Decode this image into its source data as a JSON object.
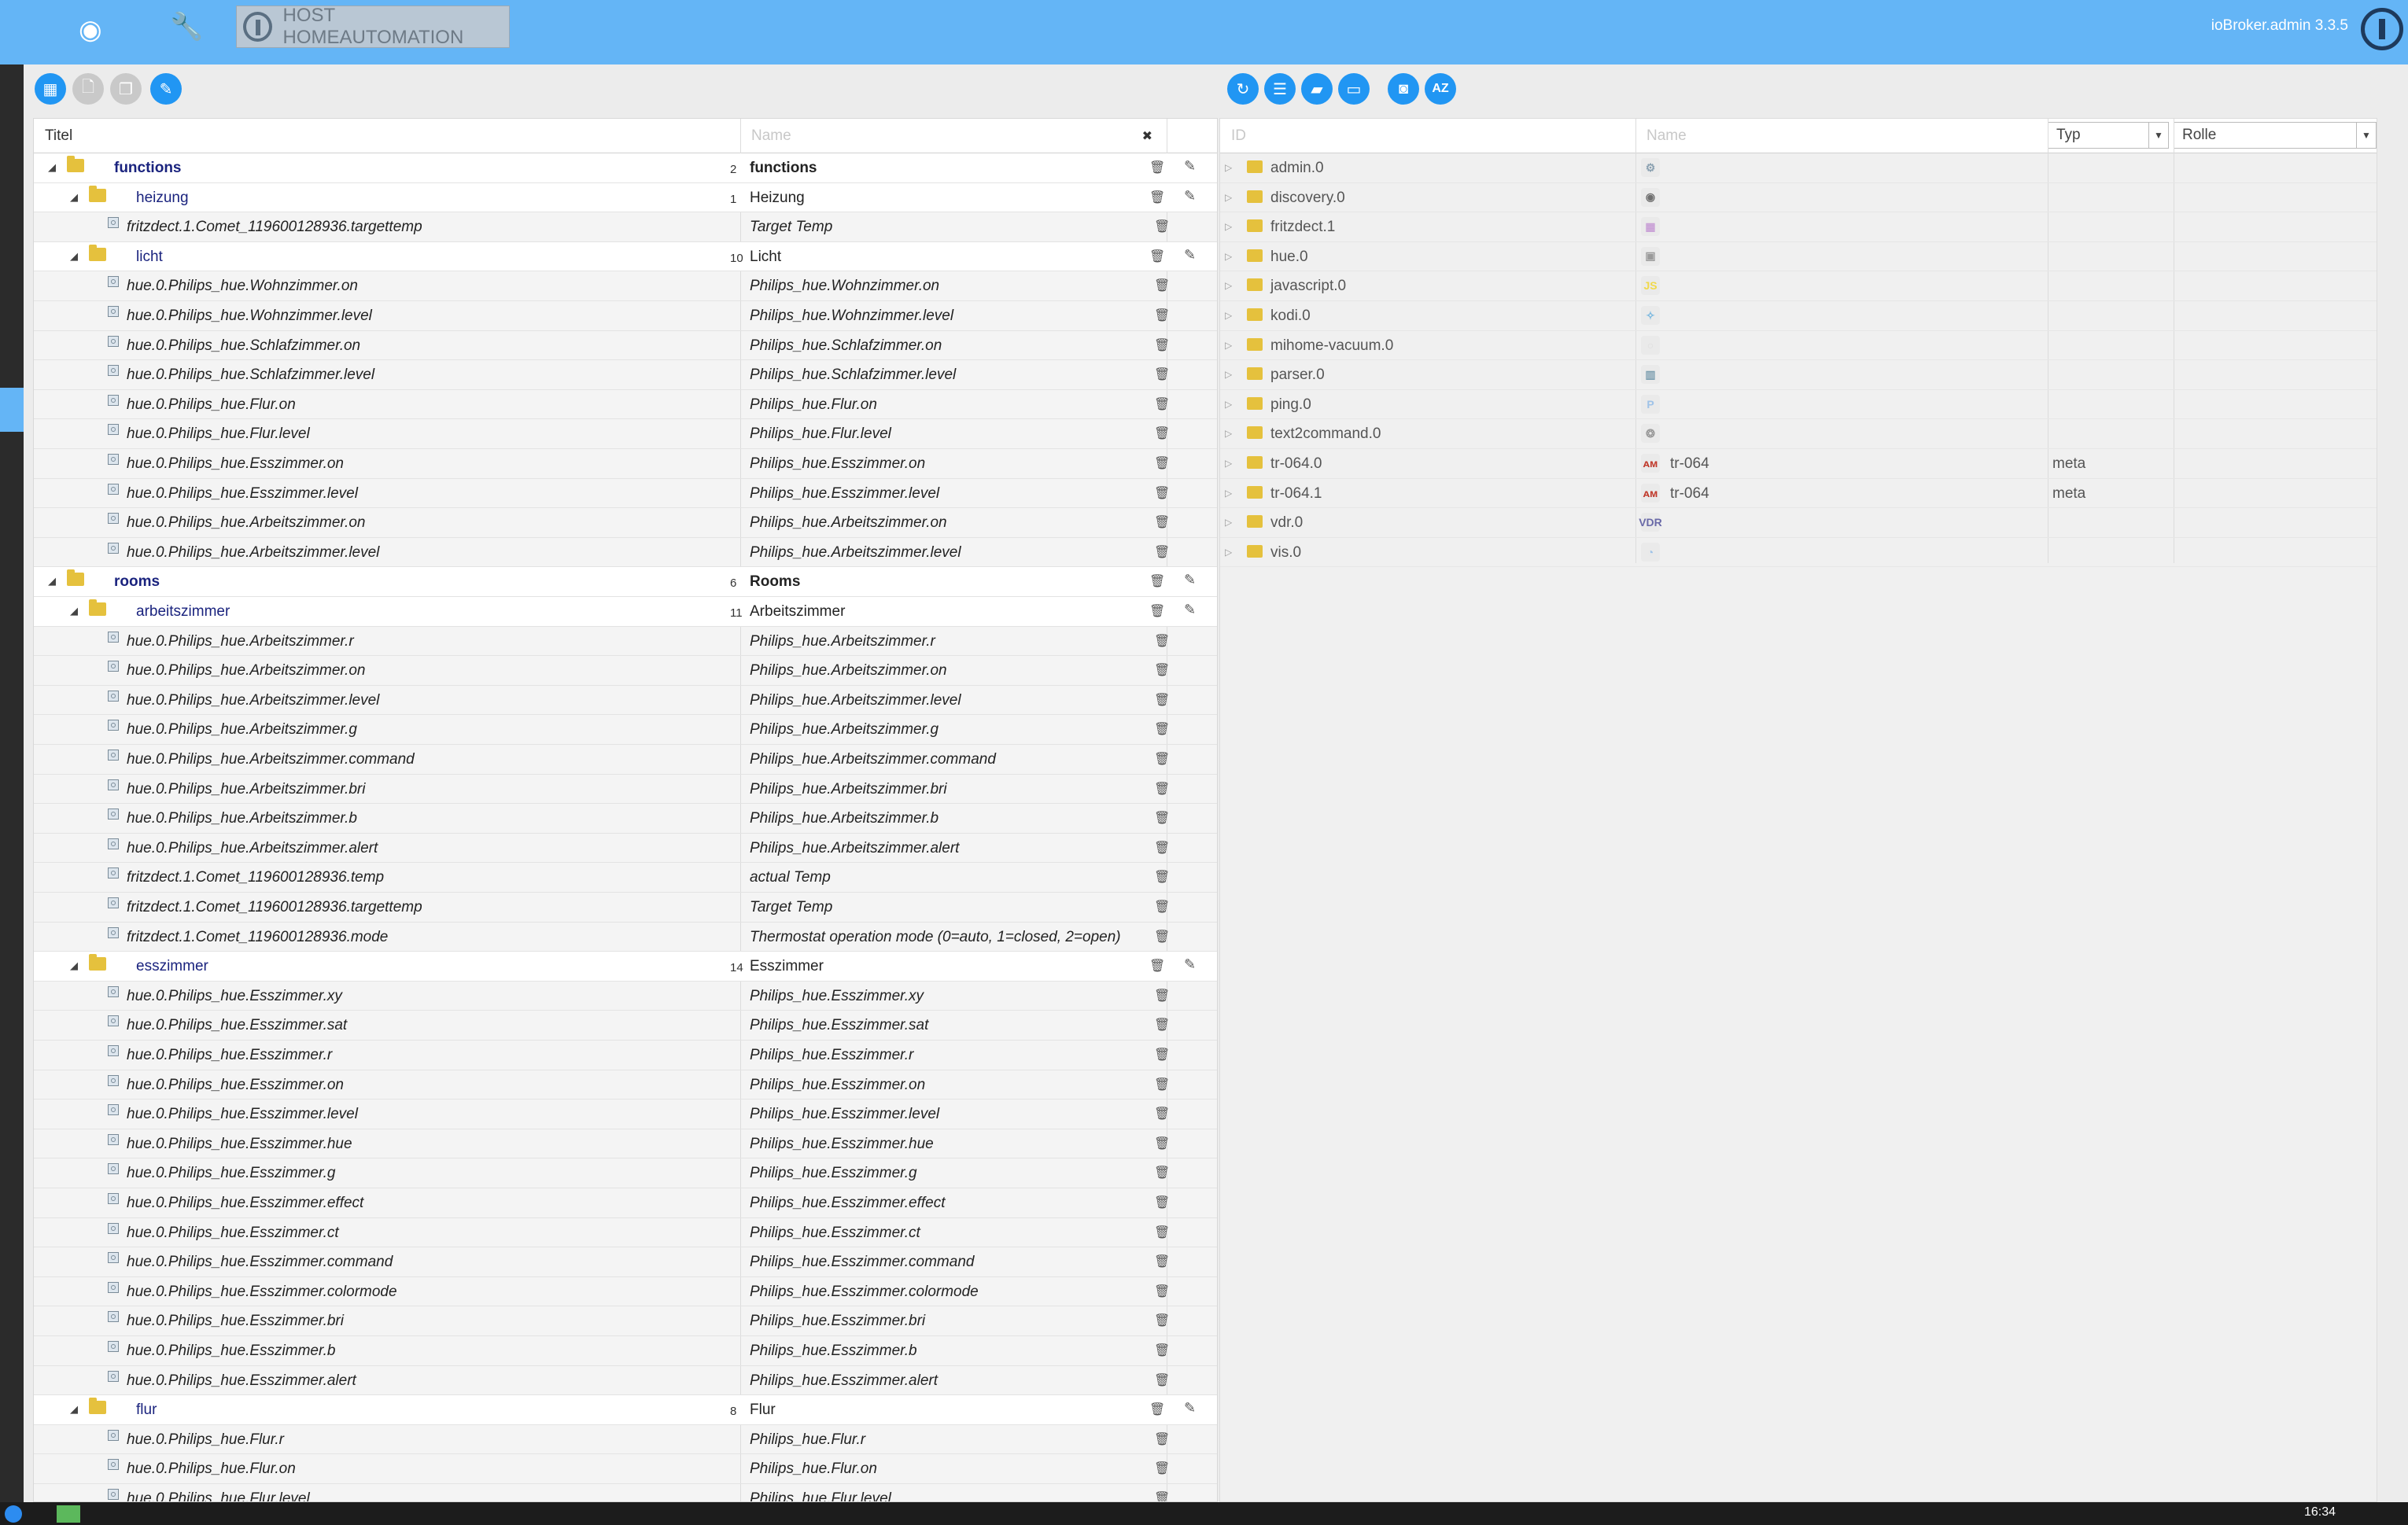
{
  "header": {
    "host_label": "HOST HOMEAUTOMATION",
    "version": "ioBroker.admin 3.3.5",
    "icons": [
      "eye-icon",
      "wrench-icon"
    ]
  },
  "left_table": {
    "columns": {
      "title": "Titel",
      "name_placeholder": "Name"
    },
    "rows": [
      {
        "type": "group",
        "level": 0,
        "title": "functions",
        "count": "2",
        "name": "functions",
        "bold": true
      },
      {
        "type": "group",
        "level": 1,
        "title": "heizung",
        "count": "1",
        "name": "Heizung"
      },
      {
        "type": "state",
        "title": "fritzdect.1.Comet_119600128936.targettemp",
        "name": "Target Temp"
      },
      {
        "type": "group",
        "level": 1,
        "title": "licht",
        "count": "10",
        "name": "Licht"
      },
      {
        "type": "state",
        "title": "hue.0.Philips_hue.Wohnzimmer.on",
        "name": "Philips_hue.Wohnzimmer.on"
      },
      {
        "type": "state",
        "title": "hue.0.Philips_hue.Wohnzimmer.level",
        "name": "Philips_hue.Wohnzimmer.level"
      },
      {
        "type": "state",
        "title": "hue.0.Philips_hue.Schlafzimmer.on",
        "name": "Philips_hue.Schlafzimmer.on"
      },
      {
        "type": "state",
        "title": "hue.0.Philips_hue.Schlafzimmer.level",
        "name": "Philips_hue.Schlafzimmer.level"
      },
      {
        "type": "state",
        "title": "hue.0.Philips_hue.Flur.on",
        "name": "Philips_hue.Flur.on"
      },
      {
        "type": "state",
        "title": "hue.0.Philips_hue.Flur.level",
        "name": "Philips_hue.Flur.level"
      },
      {
        "type": "state",
        "title": "hue.0.Philips_hue.Esszimmer.on",
        "name": "Philips_hue.Esszimmer.on"
      },
      {
        "type": "state",
        "title": "hue.0.Philips_hue.Esszimmer.level",
        "name": "Philips_hue.Esszimmer.level"
      },
      {
        "type": "state",
        "title": "hue.0.Philips_hue.Arbeitszimmer.on",
        "name": "Philips_hue.Arbeitszimmer.on"
      },
      {
        "type": "state",
        "title": "hue.0.Philips_hue.Arbeitszimmer.level",
        "name": "Philips_hue.Arbeitszimmer.level"
      },
      {
        "type": "group",
        "level": 0,
        "title": "rooms",
        "count": "6",
        "name": "Rooms",
        "bold": true
      },
      {
        "type": "group",
        "level": 1,
        "title": "arbeitszimmer",
        "count": "11",
        "name": "Arbeitszimmer"
      },
      {
        "type": "state",
        "title": "hue.0.Philips_hue.Arbeitszimmer.r",
        "name": "Philips_hue.Arbeitszimmer.r"
      },
      {
        "type": "state",
        "title": "hue.0.Philips_hue.Arbeitszimmer.on",
        "name": "Philips_hue.Arbeitszimmer.on"
      },
      {
        "type": "state",
        "title": "hue.0.Philips_hue.Arbeitszimmer.level",
        "name": "Philips_hue.Arbeitszimmer.level"
      },
      {
        "type": "state",
        "title": "hue.0.Philips_hue.Arbeitszimmer.g",
        "name": "Philips_hue.Arbeitszimmer.g"
      },
      {
        "type": "state",
        "title": "hue.0.Philips_hue.Arbeitszimmer.command",
        "name": "Philips_hue.Arbeitszimmer.command"
      },
      {
        "type": "state",
        "title": "hue.0.Philips_hue.Arbeitszimmer.bri",
        "name": "Philips_hue.Arbeitszimmer.bri"
      },
      {
        "type": "state",
        "title": "hue.0.Philips_hue.Arbeitszimmer.b",
        "name": "Philips_hue.Arbeitszimmer.b"
      },
      {
        "type": "state",
        "title": "hue.0.Philips_hue.Arbeitszimmer.alert",
        "name": "Philips_hue.Arbeitszimmer.alert"
      },
      {
        "type": "state",
        "title": "fritzdect.1.Comet_119600128936.temp",
        "name": "actual Temp"
      },
      {
        "type": "state",
        "title": "fritzdect.1.Comet_119600128936.targettemp",
        "name": "Target Temp"
      },
      {
        "type": "state",
        "title": "fritzdect.1.Comet_119600128936.mode",
        "name": "Thermostat operation mode (0=auto, 1=closed, 2=open)"
      },
      {
        "type": "group",
        "level": 1,
        "title": "esszimmer",
        "count": "14",
        "name": "Esszimmer"
      },
      {
        "type": "state",
        "title": "hue.0.Philips_hue.Esszimmer.xy",
        "name": "Philips_hue.Esszimmer.xy"
      },
      {
        "type": "state",
        "title": "hue.0.Philips_hue.Esszimmer.sat",
        "name": "Philips_hue.Esszimmer.sat"
      },
      {
        "type": "state",
        "title": "hue.0.Philips_hue.Esszimmer.r",
        "name": "Philips_hue.Esszimmer.r"
      },
      {
        "type": "state",
        "title": "hue.0.Philips_hue.Esszimmer.on",
        "name": "Philips_hue.Esszimmer.on"
      },
      {
        "type": "state",
        "title": "hue.0.Philips_hue.Esszimmer.level",
        "name": "Philips_hue.Esszimmer.level"
      },
      {
        "type": "state",
        "title": "hue.0.Philips_hue.Esszimmer.hue",
        "name": "Philips_hue.Esszimmer.hue"
      },
      {
        "type": "state",
        "title": "hue.0.Philips_hue.Esszimmer.g",
        "name": "Philips_hue.Esszimmer.g"
      },
      {
        "type": "state",
        "title": "hue.0.Philips_hue.Esszimmer.effect",
        "name": "Philips_hue.Esszimmer.effect"
      },
      {
        "type": "state",
        "title": "hue.0.Philips_hue.Esszimmer.ct",
        "name": "Philips_hue.Esszimmer.ct"
      },
      {
        "type": "state",
        "title": "hue.0.Philips_hue.Esszimmer.command",
        "name": "Philips_hue.Esszimmer.command"
      },
      {
        "type": "state",
        "title": "hue.0.Philips_hue.Esszimmer.colormode",
        "name": "Philips_hue.Esszimmer.colormode"
      },
      {
        "type": "state",
        "title": "hue.0.Philips_hue.Esszimmer.bri",
        "name": "Philips_hue.Esszimmer.bri"
      },
      {
        "type": "state",
        "title": "hue.0.Philips_hue.Esszimmer.b",
        "name": "Philips_hue.Esszimmer.b"
      },
      {
        "type": "state",
        "title": "hue.0.Philips_hue.Esszimmer.alert",
        "name": "Philips_hue.Esszimmer.alert"
      },
      {
        "type": "group",
        "level": 1,
        "title": "flur",
        "count": "8",
        "name": "Flur"
      },
      {
        "type": "state",
        "title": "hue.0.Philips_hue.Flur.r",
        "name": "Philips_hue.Flur.r"
      },
      {
        "type": "state",
        "title": "hue.0.Philips_hue.Flur.on",
        "name": "Philips_hue.Flur.on"
      },
      {
        "type": "state",
        "title": "hue.0.Philips_hue.Flur.level",
        "name": "Philips_hue.Flur.level"
      }
    ]
  },
  "right_table": {
    "columns": {
      "id_placeholder": "ID",
      "name_placeholder": "Name",
      "typ": "Typ",
      "rolle": "Rolle"
    },
    "rows": [
      {
        "id": "admin.0",
        "name": "",
        "typ": "",
        "icon": "gear-icon",
        "icon_color": "#8aa0b0",
        "icon_text": "⚙"
      },
      {
        "id": "discovery.0",
        "name": "",
        "typ": "",
        "icon": "binoculars-icon",
        "icon_color": "#6f6f6f",
        "icon_text": "◉"
      },
      {
        "id": "fritzdect.1",
        "name": "",
        "typ": "",
        "icon": "fritz-icon",
        "icon_color": "#c9a0d6",
        "icon_text": "▦"
      },
      {
        "id": "hue.0",
        "name": "",
        "typ": "",
        "icon": "hue-bridge-icon",
        "icon_color": "#9a9a9a",
        "icon_text": "▣"
      },
      {
        "id": "javascript.0",
        "name": "",
        "typ": "",
        "icon": "js-icon",
        "icon_color": "#f0d94a",
        "icon_text": "JS"
      },
      {
        "id": "kodi.0",
        "name": "",
        "typ": "",
        "icon": "kodi-icon",
        "icon_color": "#7ab8e0",
        "icon_text": "✧"
      },
      {
        "id": "mihome-vacuum.0",
        "name": "",
        "typ": "",
        "icon": "vacuum-icon",
        "icon_color": "#dcdcdc",
        "icon_text": "○"
      },
      {
        "id": "parser.0",
        "name": "",
        "typ": "",
        "icon": "parser-icon",
        "icon_color": "#7d9fb0",
        "icon_text": "▥"
      },
      {
        "id": "ping.0",
        "name": "",
        "typ": "",
        "icon": "ping-icon",
        "icon_color": "#9fc3e8",
        "icon_text": "P"
      },
      {
        "id": "text2command.0",
        "name": "",
        "typ": "",
        "icon": "brain-icon",
        "icon_color": "#9a9a9a",
        "icon_text": "❂"
      },
      {
        "id": "tr-064.0",
        "name": "tr-064",
        "typ": "meta",
        "icon": "tr064-icon",
        "icon_color": "#c0392b",
        "icon_text": "ᴀᴍ"
      },
      {
        "id": "tr-064.1",
        "name": "tr-064",
        "typ": "meta",
        "icon": "tr064-icon",
        "icon_color": "#c0392b",
        "icon_text": "ᴀᴍ"
      },
      {
        "id": "vdr.0",
        "name": "",
        "typ": "",
        "icon": "vdr-icon",
        "icon_color": "#6a6aa8",
        "icon_text": "VDR"
      },
      {
        "id": "vis.0",
        "name": "",
        "typ": "",
        "icon": "vis-icon",
        "icon_color": "#9fc3e8",
        "icon_text": "◔"
      }
    ]
  },
  "clock": "16:34"
}
